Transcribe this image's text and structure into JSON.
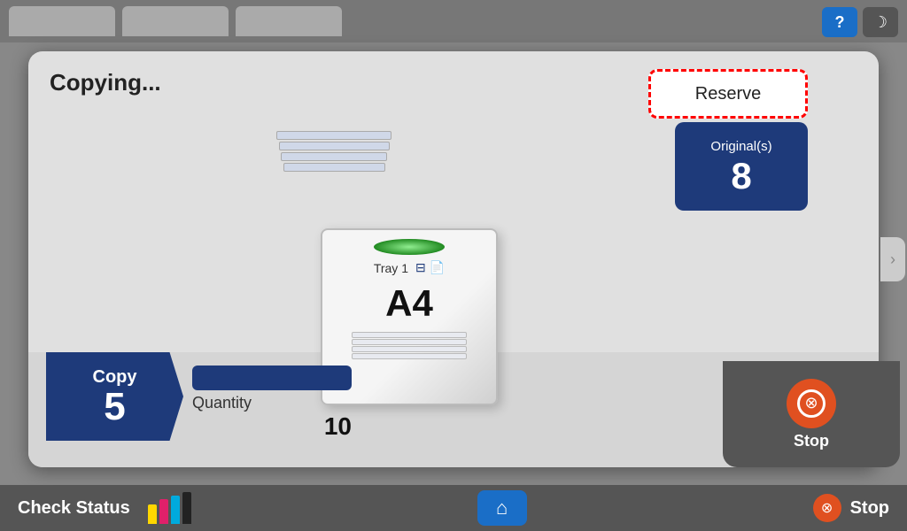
{
  "topBar": {
    "tabs": [
      "",
      "",
      ""
    ],
    "helpLabel": "?",
    "moonLabel": "☽"
  },
  "dialog": {
    "title": "Copying...",
    "reserveLabel": "Reserve",
    "originals": {
      "label": "Original(s)",
      "count": "8"
    },
    "tray": {
      "name": "Tray 1",
      "paperSize": "A4"
    },
    "copy": {
      "label": "Copy",
      "number": "5"
    },
    "quantity": {
      "label": "Quantity",
      "value": "10"
    }
  },
  "bottomBar": {
    "checkStatusLabel": "Check Status",
    "homeIcon": "⌂",
    "stopLabel": "Stop"
  }
}
